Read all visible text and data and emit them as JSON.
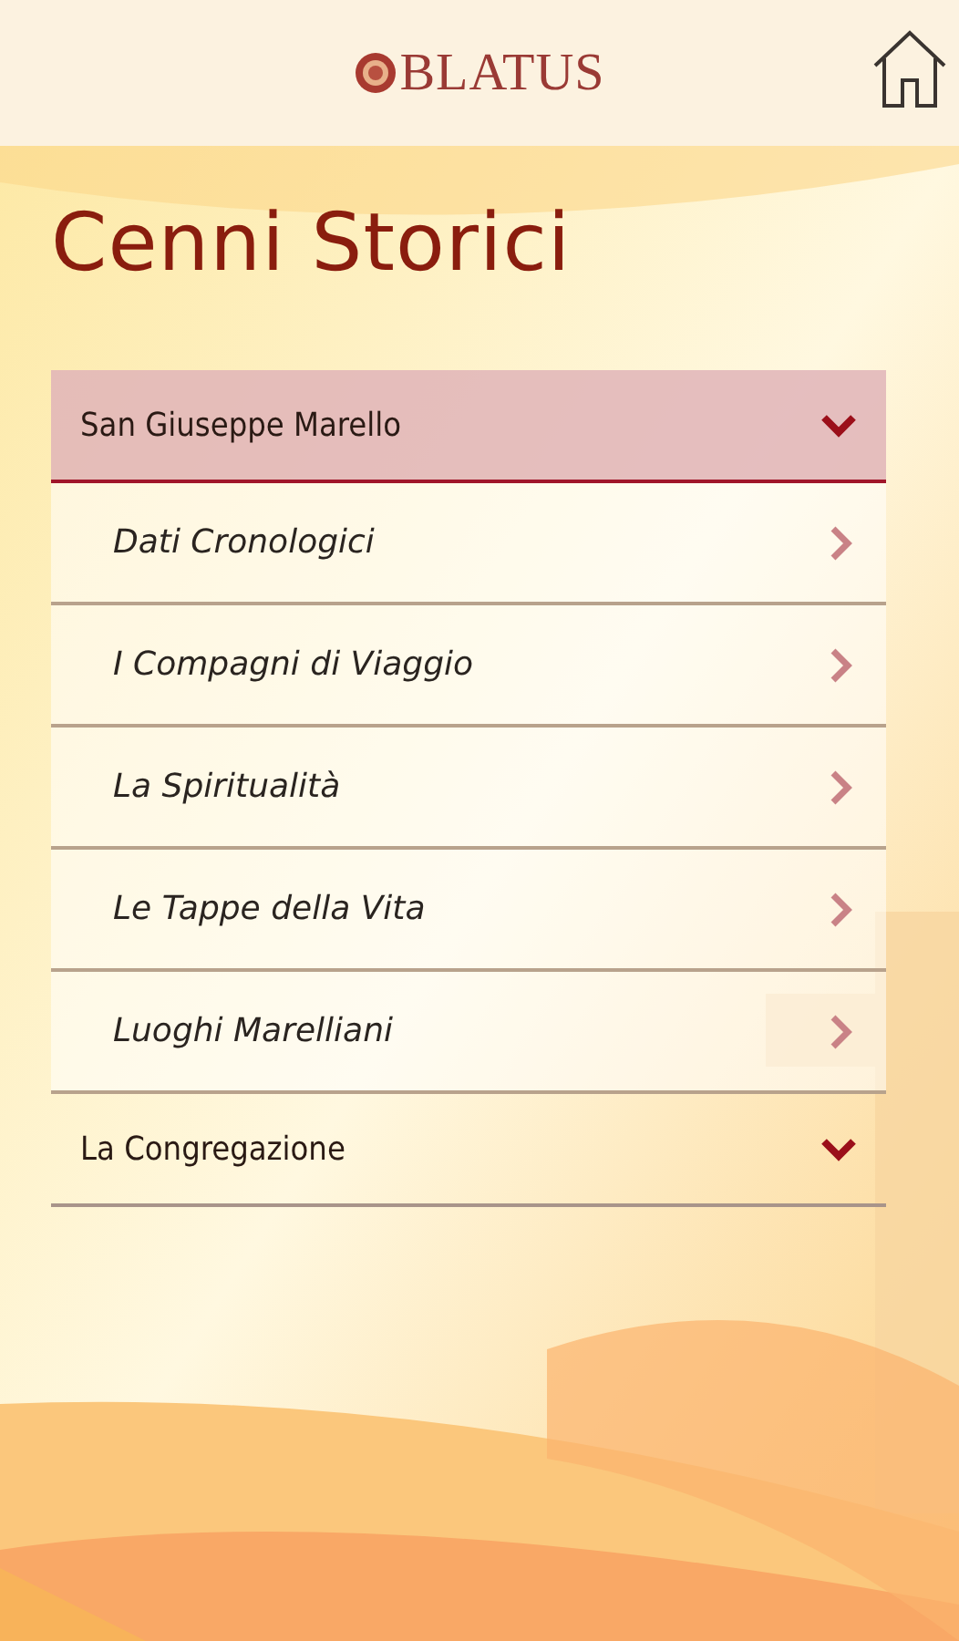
{
  "header": {
    "logo_text": "BLATUS"
  },
  "title": "Cenni Storici",
  "sections": [
    {
      "title": "San Giuseppe Marello",
      "selected": true,
      "expanded": true,
      "items": [
        {
          "label": "Dati Cronologici"
        },
        {
          "label": "I Compagni di Viaggio"
        },
        {
          "label": "La Spiritualità"
        },
        {
          "label": "Le Tappe della Vita"
        },
        {
          "label": "Luoghi Marelliani"
        }
      ]
    },
    {
      "title": "La Congregazione",
      "selected": false,
      "expanded": false
    }
  ]
}
